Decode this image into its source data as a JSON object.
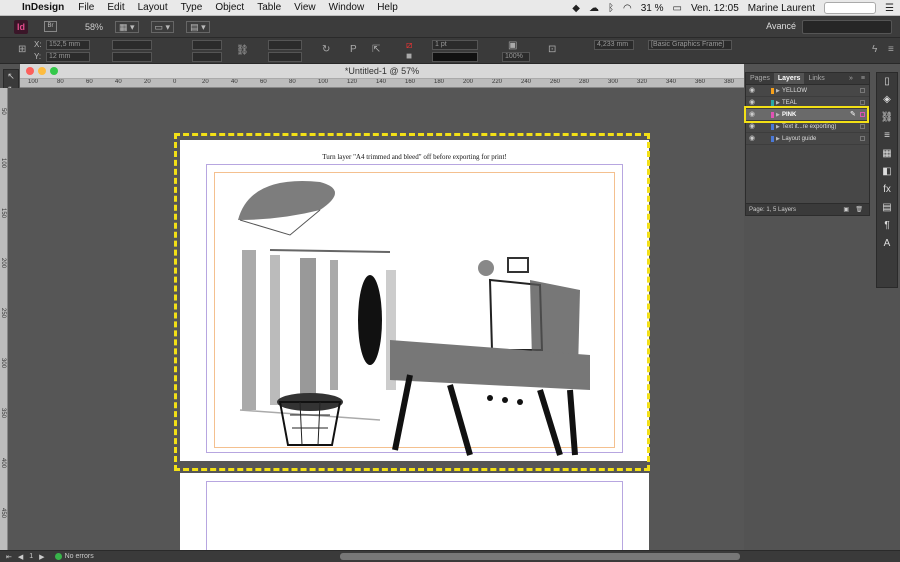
{
  "menubar": {
    "app_name": "InDesign",
    "items": [
      "File",
      "Edit",
      "Layout",
      "Type",
      "Object",
      "Table",
      "View",
      "Window",
      "Help"
    ],
    "battery": "31 %",
    "clock": "Ven. 12:05",
    "user": "Marine Laurent"
  },
  "appbar": {
    "logo": "Id",
    "bridge": "Br",
    "zoom": "58%",
    "workspace": "Avancé"
  },
  "controlbar": {
    "x_label": "X:",
    "y_label": "Y:",
    "x_value": "152,5 mm",
    "y_value": "12 mm",
    "stroke_weight": "1 pt",
    "percent": "100%",
    "width_value": "4,233 mm",
    "frame_style": "[Basic Graphics Frame]"
  },
  "document": {
    "title": "*Untitled-1 @ 57%",
    "page_note": "Turn layer \"A4 trimmed and bleed\" off before exporting for print!",
    "ruler_h": [
      "100",
      "80",
      "60",
      "40",
      "20",
      "0",
      "20",
      "40",
      "60",
      "80",
      "100",
      "120",
      "140",
      "160",
      "180",
      "200",
      "220",
      "240",
      "260",
      "280",
      "300",
      "320",
      "340",
      "360",
      "380"
    ],
    "ruler_v": [
      "50",
      "100",
      "150",
      "200",
      "250",
      "300",
      "350",
      "400",
      "450"
    ]
  },
  "layers_panel": {
    "tabs": [
      "Pages",
      "Layers",
      "Links"
    ],
    "active_tab": "Layers",
    "layers": [
      {
        "name": "YELLOW",
        "color": "#f6a01a"
      },
      {
        "name": "TEAL",
        "color": "#2aa7a5"
      },
      {
        "name": "PINK",
        "color": "#e052b4"
      },
      {
        "name": "Text it...re exporting)",
        "color": "#4a78d6"
      },
      {
        "name": "Layout guide",
        "color": "#4a78d6"
      }
    ],
    "selected_layer": "PINK",
    "footer": "Page: 1, 5 Layers"
  },
  "statusbar": {
    "page_number": "1",
    "errors": "No errors"
  },
  "colors": {
    "highlight": "#f3e016",
    "ui_dark": "#3a3a3a",
    "pasteboard": "#565656"
  }
}
